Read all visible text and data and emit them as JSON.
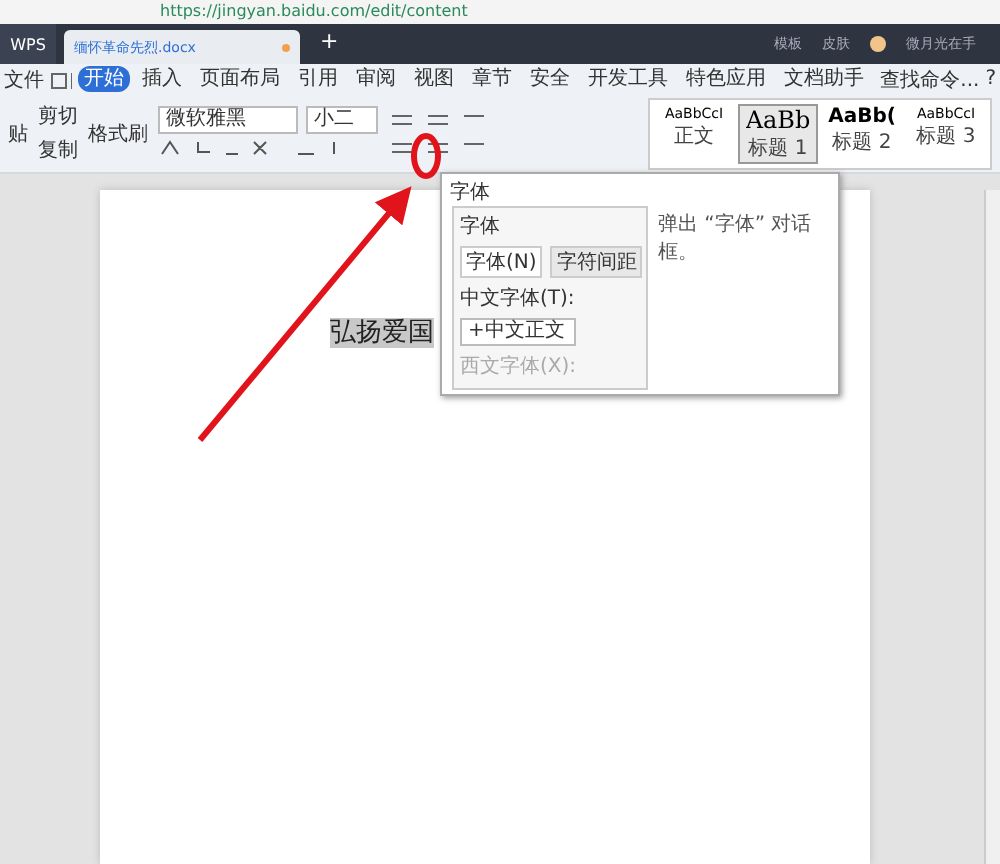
{
  "browser": {
    "url": "https://jingyan.baidu.com/edit/content"
  },
  "title_bar": {
    "app_tab": "WPS",
    "doc_tab": {
      "title": "缅怀革命先烈.docx",
      "unsaved": true
    },
    "new_tab": "+",
    "right_items": [
      "模板",
      "皮肤"
    ],
    "user": "微月光在手"
  },
  "menu": {
    "file": "文件",
    "tabs": [
      {
        "label": "开始",
        "selected": true
      },
      {
        "label": "插入",
        "selected": false
      },
      {
        "label": "页面布局",
        "selected": false
      },
      {
        "label": "引用",
        "selected": false
      },
      {
        "label": "审阅",
        "selected": false
      },
      {
        "label": "视图",
        "selected": false
      },
      {
        "label": "章节",
        "selected": false
      },
      {
        "label": "安全",
        "selected": false
      },
      {
        "label": "开发工具",
        "selected": false
      },
      {
        "label": "特色应用",
        "selected": false
      },
      {
        "label": "文档助手",
        "selected": false
      }
    ],
    "search": "查找命令...",
    "help": "?"
  },
  "ribbon": {
    "clipboard": {
      "paste": "贴",
      "cut": "剪切",
      "copy": "复制",
      "format_painter": "格式刷"
    },
    "font_name": "微软雅黑",
    "font_size": "小二",
    "styles": [
      {
        "preview": "AaBbCcI",
        "label": "正文",
        "selected": false
      },
      {
        "preview": "AaBb",
        "label": "标题 1",
        "selected": true
      },
      {
        "preview": "AaBb(",
        "label": "标题 2",
        "selected": false
      },
      {
        "preview": "AaBbCcI",
        "label": "标题 3",
        "selected": false
      }
    ]
  },
  "document": {
    "selected_text": "弘扬爱国"
  },
  "tooltip": {
    "title": "字体",
    "description": "弹出 “字体” 对话框。",
    "dialog": {
      "title": "字体",
      "tabs": [
        {
          "label": "字体(N)",
          "selected": true
        },
        {
          "label": "字符间距",
          "selected": false
        }
      ],
      "chinese_font_label": "中文字体(T):",
      "chinese_font_value": "+中文正文",
      "western_font_label": "西文字体(X):"
    }
  }
}
